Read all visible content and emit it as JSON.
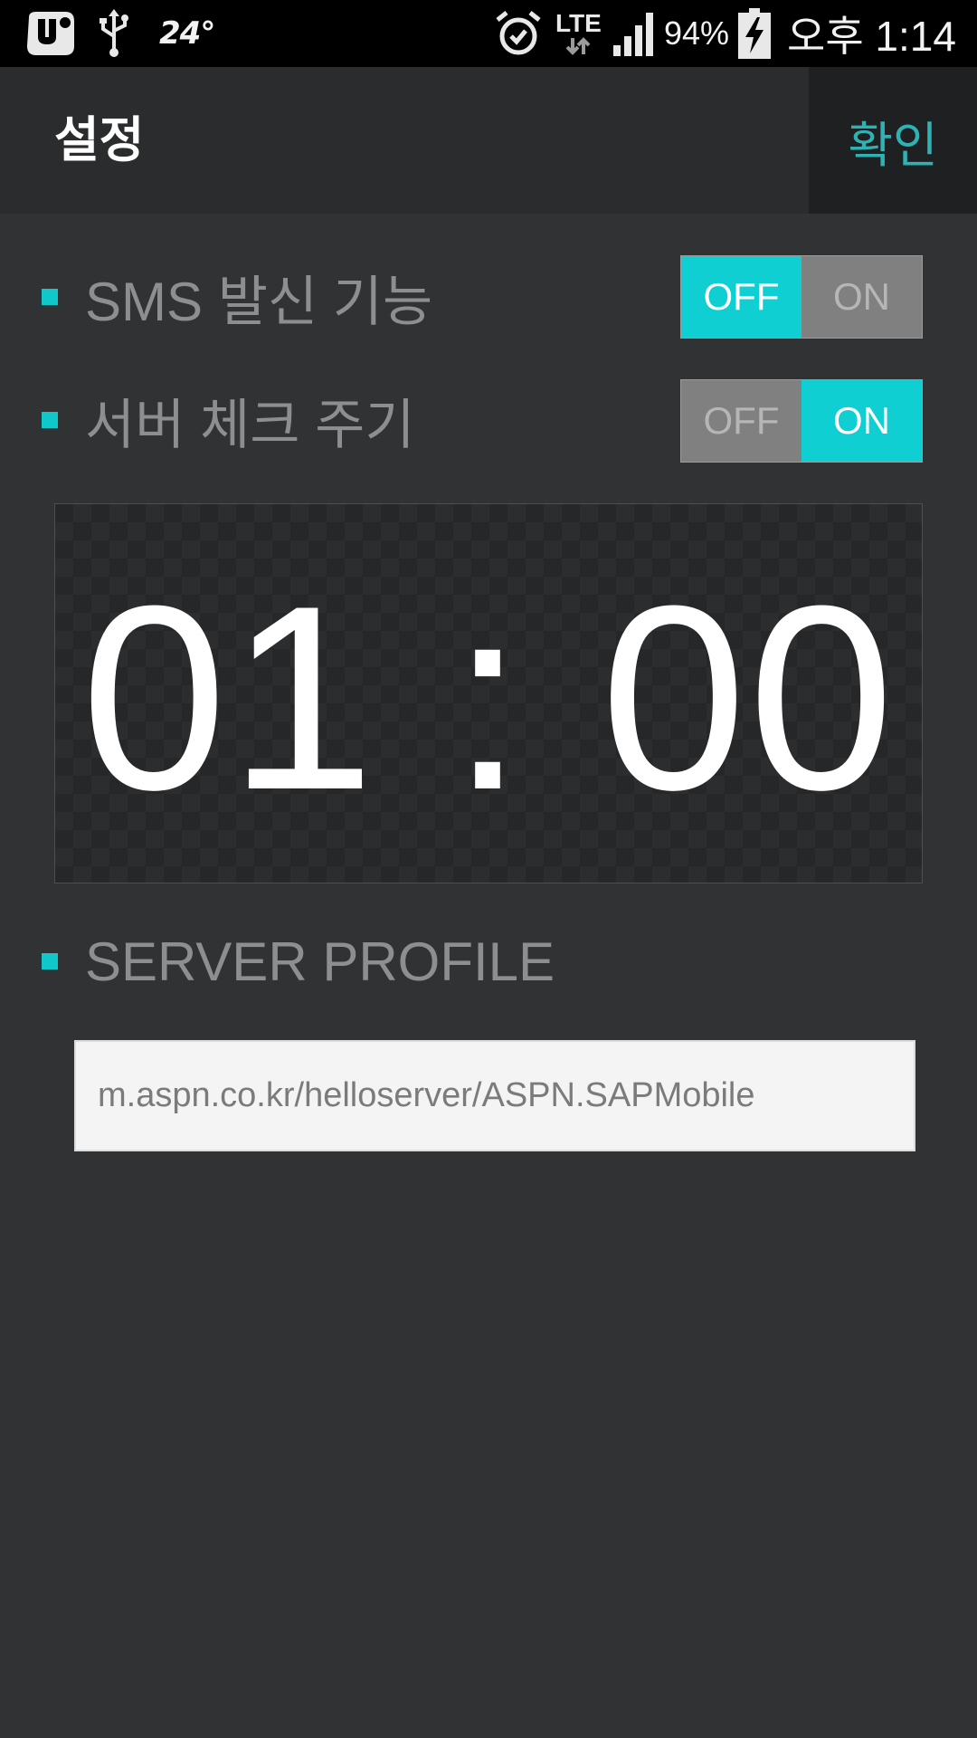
{
  "status_bar": {
    "temperature": "24°",
    "network": "LTE",
    "battery": "94%",
    "time": "오후 1:14",
    "icons": [
      "uplus-icon",
      "usb-icon",
      "alarm-icon",
      "data-arrows-icon",
      "signal-icon",
      "battery-charging-icon"
    ]
  },
  "header": {
    "title": "설정",
    "confirm_label": "확인"
  },
  "settings": {
    "sms": {
      "label": "SMS 발신 기능",
      "off_label": "OFF",
      "on_label": "ON",
      "state": "OFF"
    },
    "server_check": {
      "label": "서버 체크 주기",
      "off_label": "OFF",
      "on_label": "ON",
      "state": "ON"
    }
  },
  "interval": {
    "display": "01 : 00"
  },
  "server_profile": {
    "label": "SERVER PROFILE",
    "url": "m.aspn.co.kr/helloserver/ASPN.SAPMobile"
  },
  "colors": {
    "accent": "#0fcfd2",
    "confirm_text": "#2fb2b5",
    "background": "#313234"
  }
}
